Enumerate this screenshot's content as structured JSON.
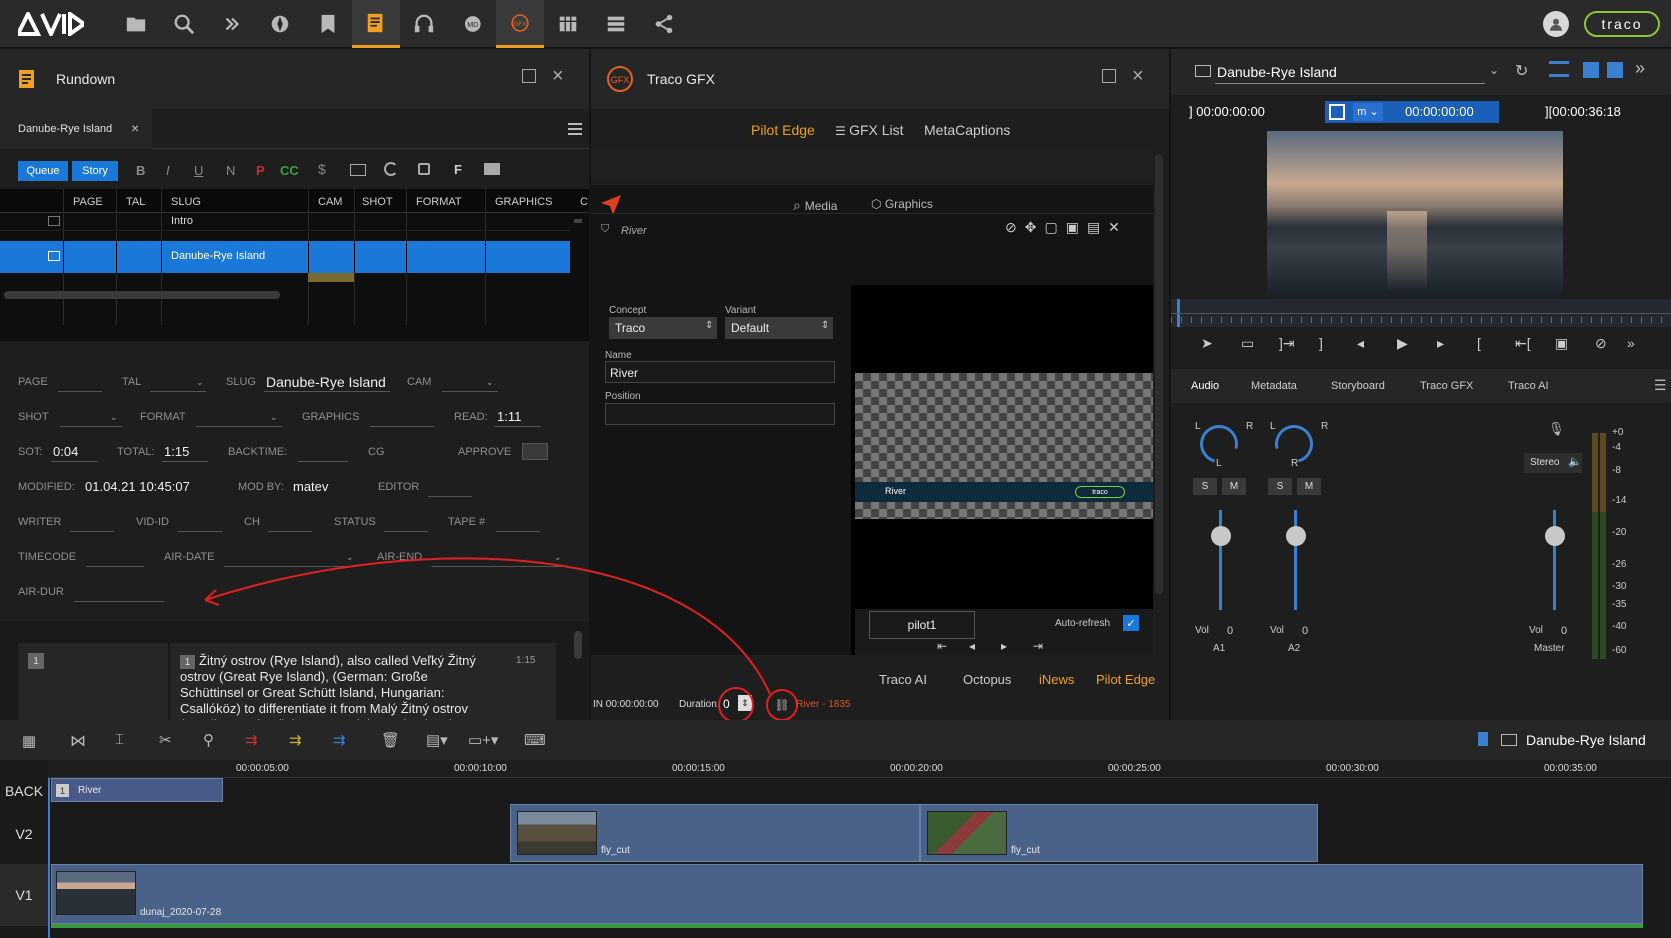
{
  "brand": {
    "logo": "AVID",
    "traco_logo": "traco"
  },
  "colors": {
    "accent_orange": "#f0a020",
    "selection_blue": "#1a78d8",
    "link_blue": "#2a5fb8",
    "clip_blue": "#4a6189"
  },
  "toolbar_icons": [
    "folder-icon",
    "search-icon",
    "network-icon",
    "explorer-icon",
    "bookmark-icon",
    "rundown-icon",
    "headset-icon",
    "md-icon",
    "gfx-icon",
    "grid-icon",
    "list-icon",
    "share-icon"
  ],
  "rundown": {
    "title": "Rundown",
    "tab": "Danube-Rye Island",
    "queue_btn": "Queue",
    "story_btn": "Story",
    "fmt_buttons": [
      "B",
      "I",
      "U",
      "N",
      "P",
      "CC"
    ],
    "columns": [
      "PAGE",
      "TAL",
      "SLUG",
      "CAM",
      "SHOT",
      "FORMAT",
      "GRAPHICS",
      "C"
    ],
    "rows": [
      {
        "slug": "Intro"
      },
      {
        "slug": "Danube-Rye Island"
      }
    ],
    "fields": {
      "page": "PAGE",
      "tal": "TAL",
      "slug_label": "SLUG",
      "slug_value": "Danube-Rye Island",
      "cam": "CAM",
      "shot": "SHOT",
      "format": "FORMAT",
      "graphics": "GRAPHICS",
      "read_label": "READ:",
      "read_value": "1:11",
      "sot_label": "SOT:",
      "sot_value": "0:04",
      "total_label": "TOTAL:",
      "total_value": "1:15",
      "backtime": "BACKTIME:",
      "cg": "CG",
      "approve": "APPROVE",
      "modified_label": "MODIFIED:",
      "modified_value": "01.04.21 10:45:07",
      "modby_label": "MOD BY:",
      "modby_value": "matev",
      "editor": "EDITOR",
      "writer": "WRITER",
      "vidid": "VID-ID",
      "ch": "CH",
      "status": "STATUS",
      "tape": "TAPE #",
      "timecode": "TIMECODE",
      "airdate": "AIR-DATE",
      "airend": "AIR-END",
      "airdur": "AIR-DUR"
    },
    "script": {
      "badge": "1",
      "inline_badge": "1",
      "time": "1:15",
      "text": "Žitný ostrov (Rye Island), also called Veľký Žitný ostrov (Great Rye Island), (German: Große Schüttinsel or Great Schütt Island, Hungarian: Csallóköz) to differentiate it from Malý Žitný ostrov (Small Rye Island) (German: Kleine Schüttinsel or Little Schütt Island, Hungarian: Szigetköz), is a river island in southwestern Slovakia, extending from"
    }
  },
  "gfx": {
    "title": "Traco GFX",
    "tabs": [
      "Pilot Edge",
      "GFX List",
      "MetaCaptions"
    ],
    "media_tab": "Media",
    "graphics_tab": "Graphics",
    "item_name": "River",
    "concept_label": "Concept",
    "concept_value": "Traco",
    "variant_label": "Variant",
    "variant_value": "Default",
    "name_label": "Name",
    "name_value": "River",
    "position_label": "Position",
    "preview_lower_third": "River",
    "preview_logo": "traco",
    "pilot_input": "pilot1",
    "autorefresh": "Auto-refresh",
    "bottom_tabs": [
      "Traco AI",
      "Octopus",
      "iNews",
      "Pilot Edge"
    ],
    "in_label": "IN 00:00:00:00",
    "duration_label": "Duration",
    "duration_value": "0",
    "river_ref": "River - 1835"
  },
  "player": {
    "title": "Danube-Rye Island",
    "tc_in": "00:00:00:00",
    "mode": "m",
    "tc_current": "00:00:00:00",
    "tc_out": "00:00:36:18",
    "tabs": [
      "Audio",
      "Metadata",
      "Storyboard",
      "Traco GFX",
      "Traco AI"
    ],
    "channels": [
      {
        "l": "L",
        "r": "R",
        "pan": "L",
        "vol_label": "Vol",
        "vol": "0",
        "name": "A1"
      },
      {
        "l": "L",
        "r": "R",
        "pan": "R",
        "vol_label": "Vol",
        "vol": "0",
        "name": "A2"
      }
    ],
    "master": {
      "mode": "Stereo",
      "vol_label": "Vol",
      "vol": "0",
      "name": "Master"
    },
    "sm": [
      "S",
      "M"
    ],
    "meter_scale": [
      "+0",
      "-4",
      "-8",
      "-14",
      "-20",
      "-26",
      "-30",
      "-35",
      "-40",
      "-60"
    ]
  },
  "timeline": {
    "sequence_name": "Danube-Rye Island",
    "ruler": [
      "00:00:05:00",
      "00:00:10:00",
      "00:00:15:00",
      "00:00:20:00",
      "00:00:25:00",
      "00:00:30:00",
      "00:00:35:00"
    ],
    "tracks": [
      "BACK",
      "V2",
      "V1"
    ],
    "back_clip": {
      "badge": "1",
      "name": "River"
    },
    "v2_clips": [
      "fly_cut",
      "fly_cut"
    ],
    "v1_clip": "dunaj_2020-07-28"
  }
}
